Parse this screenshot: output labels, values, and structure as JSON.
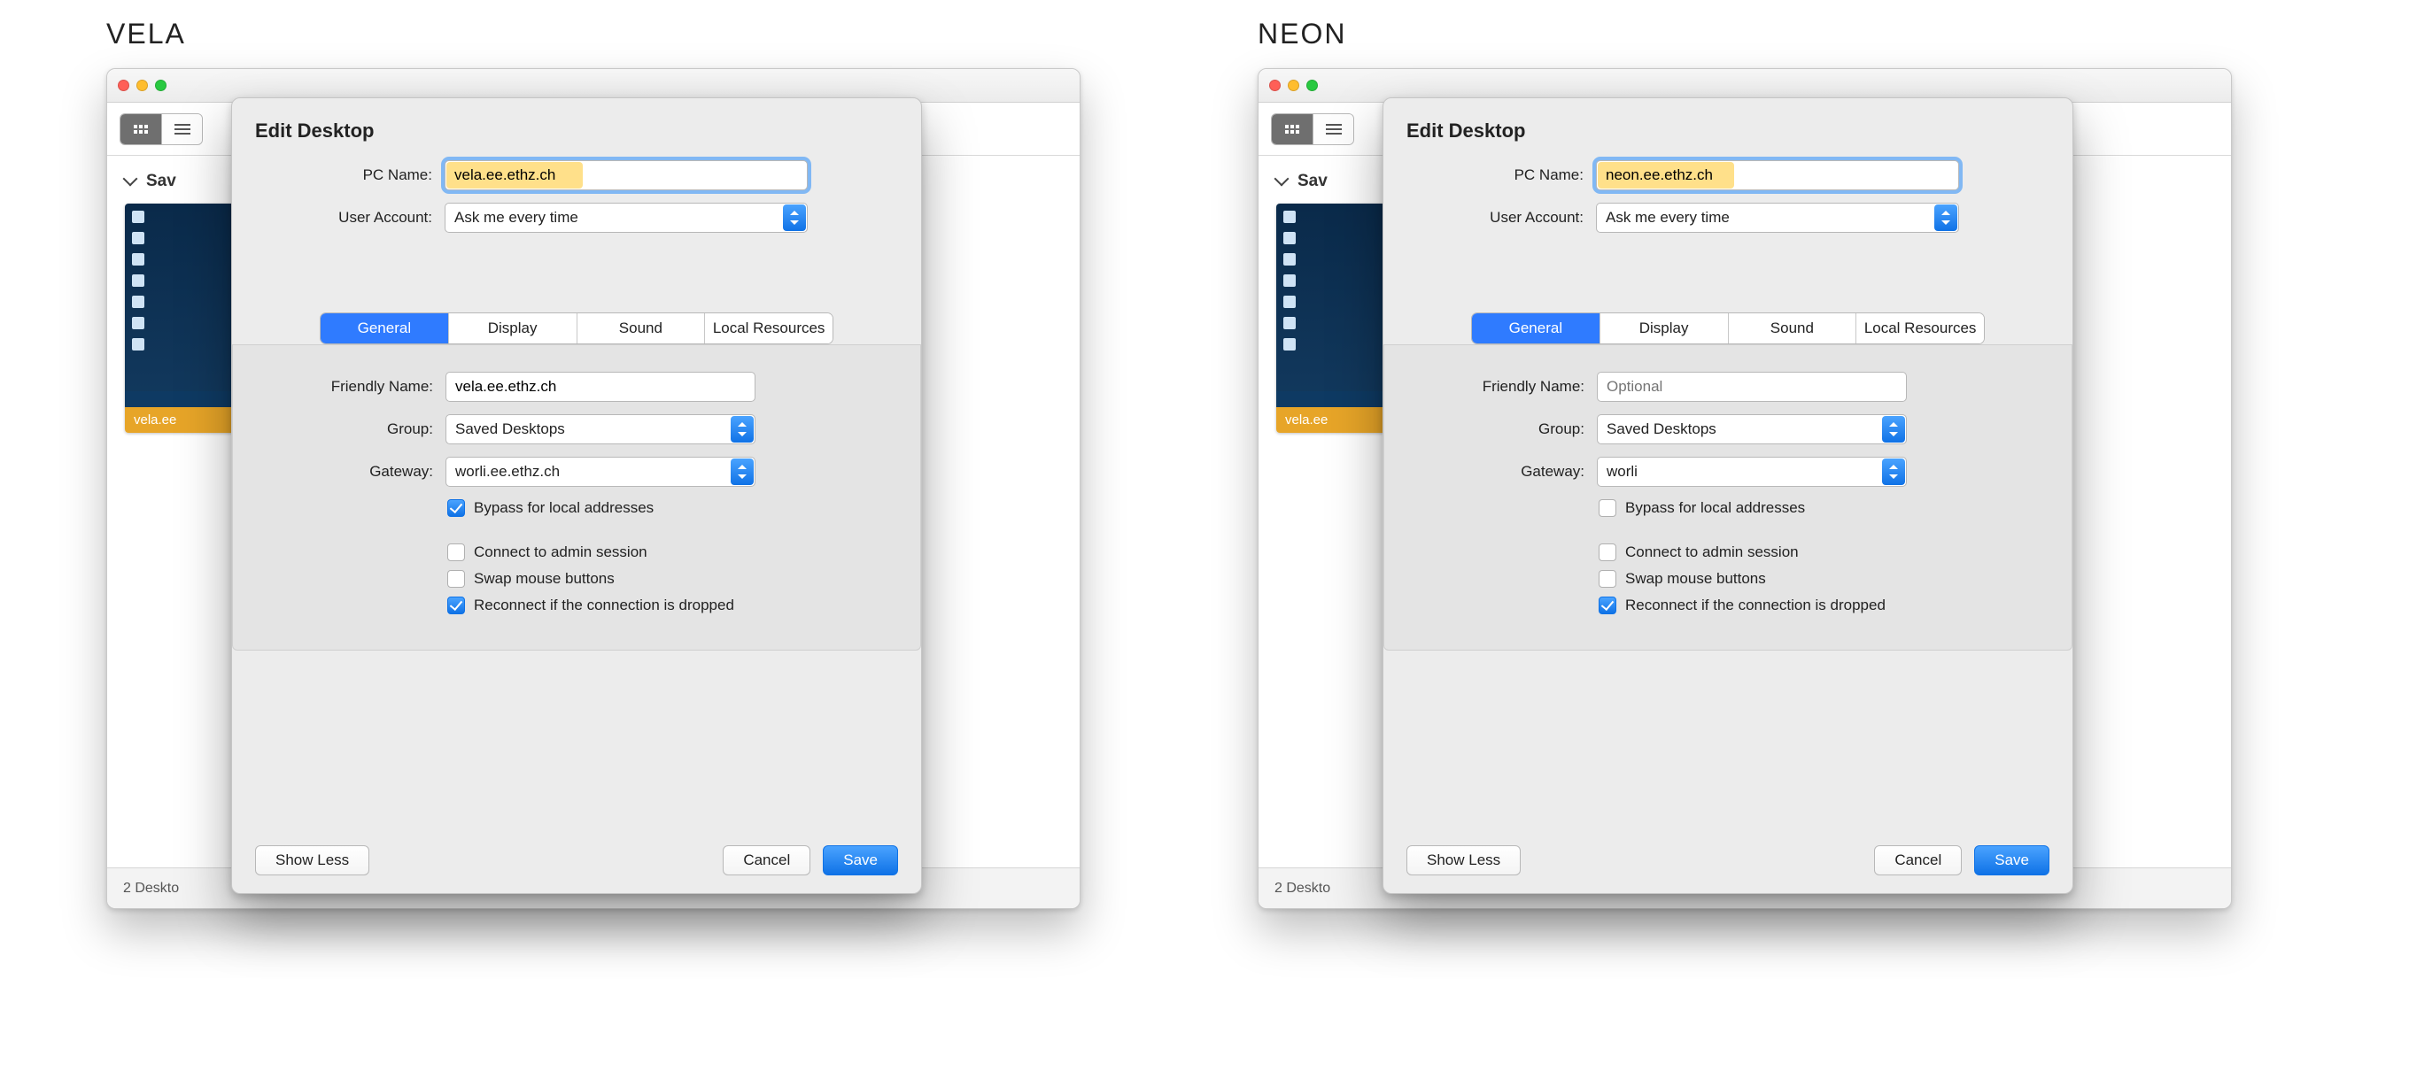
{
  "columns": [
    {
      "title": "VELA",
      "back": {
        "section": "Sav",
        "thumb_label": "vela.ee",
        "status": "2 Deskto"
      },
      "sheet": {
        "heading": "Edit Desktop",
        "pc_name_label": "PC Name:",
        "pc_name_value": "vela.ee.ethz.ch",
        "user_account_label": "User Account:",
        "user_account_value": "Ask me every time",
        "tabs": {
          "general": "General",
          "display": "Display",
          "sound": "Sound",
          "local": "Local Resources"
        },
        "friendly_label": "Friendly Name:",
        "friendly_value": "vela.ee.ethz.ch",
        "friendly_placeholder": "",
        "group_label": "Group:",
        "group_value": "Saved Desktops",
        "gateway_label": "Gateway:",
        "gateway_value": "worli.ee.ethz.ch",
        "bypass_checked": true,
        "bypass_label": "Bypass for local addresses",
        "admin_checked": false,
        "admin_label": "Connect to admin session",
        "swap_checked": false,
        "swap_label": "Swap mouse buttons",
        "reconnect_checked": true,
        "reconnect_label": "Reconnect if the connection is dropped",
        "show_less": "Show Less",
        "cancel": "Cancel",
        "save": "Save"
      }
    },
    {
      "title": "NEON",
      "back": {
        "section": "Sav",
        "thumb_label": "vela.ee",
        "status": "2 Deskto"
      },
      "sheet": {
        "heading": "Edit Desktop",
        "pc_name_label": "PC Name:",
        "pc_name_value": "neon.ee.ethz.ch",
        "user_account_label": "User Account:",
        "user_account_value": "Ask me every time",
        "tabs": {
          "general": "General",
          "display": "Display",
          "sound": "Sound",
          "local": "Local Resources"
        },
        "friendly_label": "Friendly Name:",
        "friendly_value": "",
        "friendly_placeholder": "Optional",
        "group_label": "Group:",
        "group_value": "Saved Desktops",
        "gateway_label": "Gateway:",
        "gateway_value": "worli",
        "bypass_checked": false,
        "bypass_label": "Bypass for local addresses",
        "admin_checked": false,
        "admin_label": "Connect to admin session",
        "swap_checked": false,
        "swap_label": "Swap mouse buttons",
        "reconnect_checked": true,
        "reconnect_label": "Reconnect if the connection is dropped",
        "show_less": "Show Less",
        "cancel": "Cancel",
        "save": "Save"
      }
    }
  ]
}
